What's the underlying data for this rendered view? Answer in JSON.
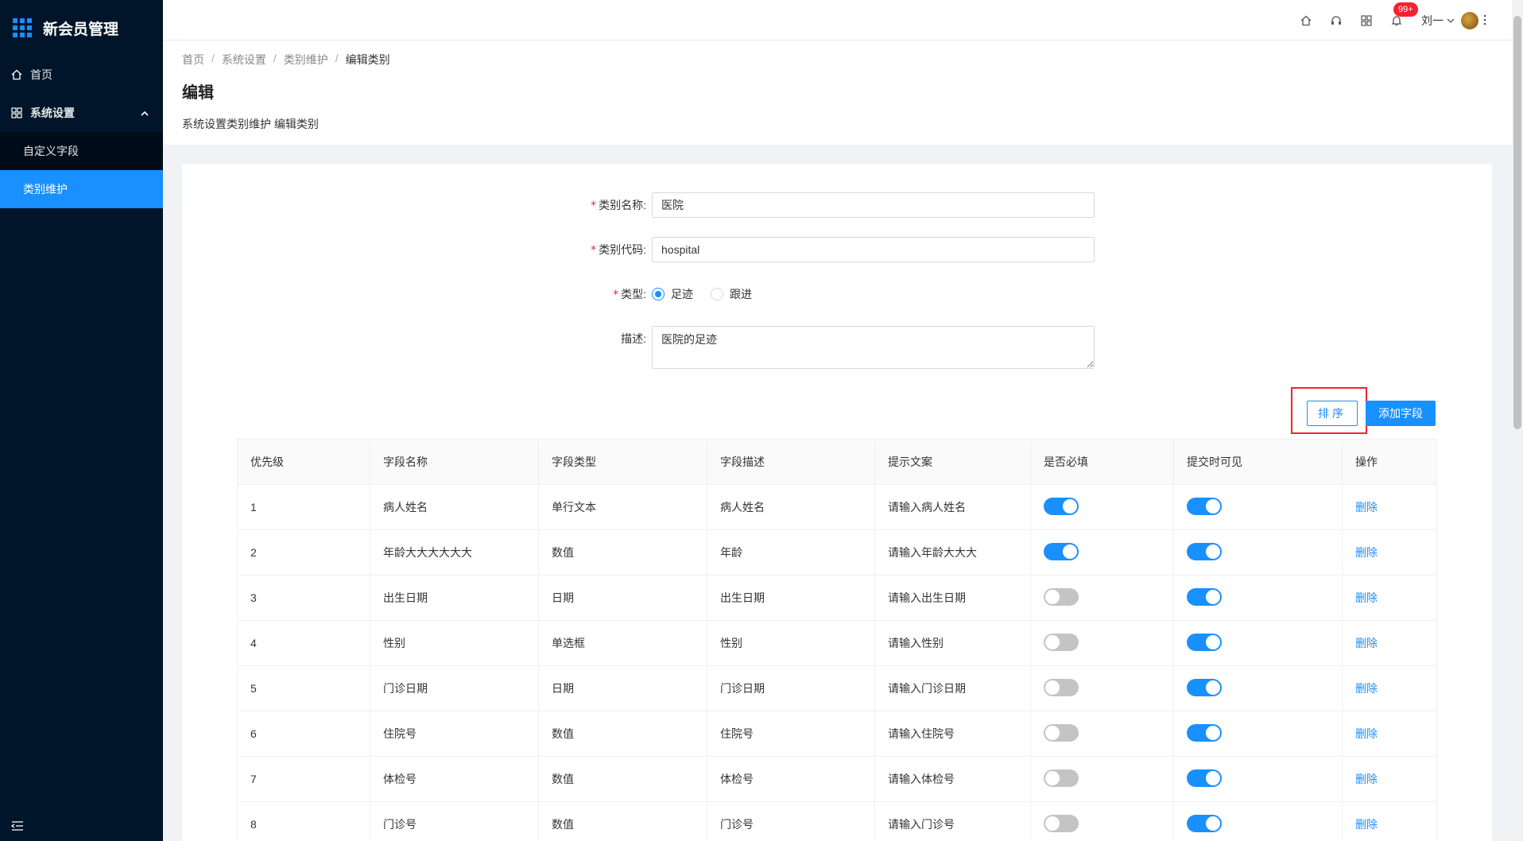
{
  "app": {
    "title": "新会员管理"
  },
  "sidebar": {
    "items": [
      {
        "label": "首页",
        "icon": "home-icon"
      },
      {
        "label": "系统设置",
        "icon": "appstore-icon",
        "expanded": true,
        "children": [
          {
            "label": "自定义字段",
            "active": false
          },
          {
            "label": "类别维护",
            "active": true
          }
        ]
      }
    ]
  },
  "header": {
    "badge": "99+",
    "user_name": "刘一",
    "icons": [
      "home-icon",
      "headset-icon",
      "grid-icon",
      "bell-icon"
    ]
  },
  "page": {
    "breadcrumb": [
      "首页",
      "系统设置",
      "类别维护",
      "编辑类别"
    ],
    "title": "编辑",
    "description": "系统设置类别维护 编辑类别"
  },
  "form": {
    "name_label": "类别名称:",
    "name_value": "医院",
    "code_label": "类别代码:",
    "code_value": "hospital",
    "type_label": "类型:",
    "type_options": [
      "足迹",
      "跟进"
    ],
    "type_selected": "足迹",
    "desc_label": "描述:",
    "desc_value": "医院的足迹"
  },
  "buttons": {
    "sort": "排序",
    "add_field": "添加字段"
  },
  "table": {
    "headers": [
      "优先级",
      "字段名称",
      "字段类型",
      "字段描述",
      "提示文案",
      "是否必填",
      "提交时可见",
      "操作"
    ],
    "rows": [
      {
        "priority": "1",
        "name": "病人姓名",
        "type": "单行文本",
        "desc": "病人姓名",
        "hint": "请输入病人姓名",
        "required": true,
        "visible": true,
        "action": "删除"
      },
      {
        "priority": "2",
        "name": "年龄大大大大大大",
        "type": "数值",
        "desc": "年龄",
        "hint": "请输入年龄大大大",
        "required": true,
        "visible": true,
        "action": "删除"
      },
      {
        "priority": "3",
        "name": "出生日期",
        "type": "日期",
        "desc": "出生日期",
        "hint": "请输入出生日期",
        "required": false,
        "visible": true,
        "action": "删除"
      },
      {
        "priority": "4",
        "name": "性别",
        "type": "单选框",
        "desc": "性别",
        "hint": "请输入性别",
        "required": false,
        "visible": true,
        "action": "删除"
      },
      {
        "priority": "5",
        "name": "门诊日期",
        "type": "日期",
        "desc": "门诊日期",
        "hint": "请输入门诊日期",
        "required": false,
        "visible": true,
        "action": "删除"
      },
      {
        "priority": "6",
        "name": "住院号",
        "type": "数值",
        "desc": "住院号",
        "hint": "请输入住院号",
        "required": false,
        "visible": true,
        "action": "删除"
      },
      {
        "priority": "7",
        "name": "体检号",
        "type": "数值",
        "desc": "体检号",
        "hint": "请输入体检号",
        "required": false,
        "visible": true,
        "action": "删除"
      },
      {
        "priority": "8",
        "name": "门诊号",
        "type": "数值",
        "desc": "门诊号",
        "hint": "请输入门诊号",
        "required": false,
        "visible": true,
        "action": "删除"
      }
    ]
  },
  "colors": {
    "primary": "#1890ff",
    "sidebar": "#001529",
    "danger": "#f5222d"
  }
}
